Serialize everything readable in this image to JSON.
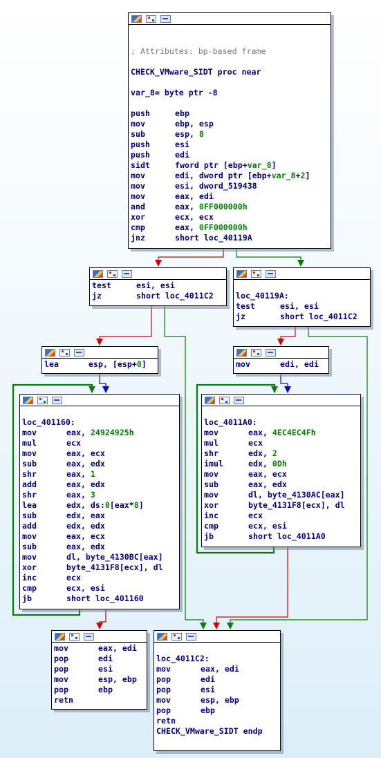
{
  "colors": {
    "edge_true": "#008000",
    "edge_false": "#d00000",
    "edge_uncond": "#0000ff",
    "text": "#000080",
    "number": "#008000",
    "comment": "#7a7a7a"
  },
  "node_header_icons": [
    "color-icon",
    "graph-icon",
    "text-icon"
  ],
  "nodes": [
    {
      "id": "n1",
      "lines": [
        {
          "type": "blank"
        },
        {
          "type": "blank"
        },
        {
          "type": "comment",
          "text": "; Attributes: bp-based frame"
        },
        {
          "type": "blank"
        },
        {
          "type": "label",
          "text": "CHECK_VMware_SIDT proc near"
        },
        {
          "type": "blank"
        },
        {
          "type": "label",
          "text": "var_8= byte ptr -8"
        },
        {
          "type": "blank"
        },
        {
          "type": "ins",
          "mnem": "push",
          "ops": [
            {
              "t": "ebp"
            }
          ]
        },
        {
          "type": "ins",
          "mnem": "mov",
          "ops": [
            {
              "t": "ebp, esp"
            }
          ]
        },
        {
          "type": "ins",
          "mnem": "sub",
          "ops": [
            {
              "t": "esp, "
            },
            {
              "t": "8",
              "n": true
            }
          ]
        },
        {
          "type": "ins",
          "mnem": "push",
          "ops": [
            {
              "t": "esi"
            }
          ]
        },
        {
          "type": "ins",
          "mnem": "push",
          "ops": [
            {
              "t": "edi"
            }
          ]
        },
        {
          "type": "ins",
          "mnem": "sidt",
          "ops": [
            {
              "t": "fword ptr [ebp+"
            },
            {
              "t": "var_8",
              "n": true
            },
            {
              "t": "]"
            }
          ]
        },
        {
          "type": "ins",
          "mnem": "mov",
          "ops": [
            {
              "t": "edi, dword ptr [ebp+"
            },
            {
              "t": "var_8",
              "n": true
            },
            {
              "t": "+"
            },
            {
              "t": "2",
              "n": true
            },
            {
              "t": "]"
            }
          ]
        },
        {
          "type": "ins",
          "mnem": "mov",
          "ops": [
            {
              "t": "esi, dword_519438"
            }
          ]
        },
        {
          "type": "ins",
          "mnem": "mov",
          "ops": [
            {
              "t": "eax, edi"
            }
          ]
        },
        {
          "type": "ins",
          "mnem": "and",
          "ops": [
            {
              "t": "eax, "
            },
            {
              "t": "0FF000000h",
              "n": true
            }
          ]
        },
        {
          "type": "ins",
          "mnem": "xor",
          "ops": [
            {
              "t": "ecx, ecx"
            }
          ]
        },
        {
          "type": "ins",
          "mnem": "cmp",
          "ops": [
            {
              "t": "eax, "
            },
            {
              "t": "0FF000000h",
              "n": true
            }
          ]
        },
        {
          "type": "ins",
          "mnem": "jnz",
          "ops": [
            {
              "t": "short loc_40119A"
            }
          ]
        }
      ]
    },
    {
      "id": "n2",
      "lines": [
        {
          "type": "ins",
          "mnem": "test",
          "ops": [
            {
              "t": "esi, esi"
            }
          ]
        },
        {
          "type": "ins",
          "mnem": "jz",
          "ops": [
            {
              "t": "short loc_4011C2"
            }
          ]
        }
      ]
    },
    {
      "id": "n3",
      "lines": [
        {
          "type": "blank"
        },
        {
          "type": "label",
          "text": "loc_40119A:"
        },
        {
          "type": "ins",
          "mnem": "test",
          "ops": [
            {
              "t": "esi, esi"
            }
          ]
        },
        {
          "type": "ins",
          "mnem": "jz",
          "ops": [
            {
              "t": "short loc_4011C2"
            }
          ]
        }
      ]
    },
    {
      "id": "n4",
      "lines": [
        {
          "type": "ins",
          "mnem": "lea",
          "ops": [
            {
              "t": "esp, [esp+"
            },
            {
              "t": "0",
              "n": true
            },
            {
              "t": "]"
            }
          ]
        }
      ]
    },
    {
      "id": "n5",
      "lines": [
        {
          "type": "ins",
          "mnem": "mov",
          "ops": [
            {
              "t": "edi, edi"
            }
          ]
        }
      ]
    },
    {
      "id": "n6",
      "lines": [
        {
          "type": "blank"
        },
        {
          "type": "label",
          "text": "loc_401160:"
        },
        {
          "type": "ins",
          "mnem": "mov",
          "ops": [
            {
              "t": "eax, "
            },
            {
              "t": "24924925h",
              "n": true
            }
          ]
        },
        {
          "type": "ins",
          "mnem": "mul",
          "ops": [
            {
              "t": "ecx"
            }
          ]
        },
        {
          "type": "ins",
          "mnem": "mov",
          "ops": [
            {
              "t": "eax, ecx"
            }
          ]
        },
        {
          "type": "ins",
          "mnem": "sub",
          "ops": [
            {
              "t": "eax, edx"
            }
          ]
        },
        {
          "type": "ins",
          "mnem": "shr",
          "ops": [
            {
              "t": "eax, "
            },
            {
              "t": "1",
              "n": true
            }
          ]
        },
        {
          "type": "ins",
          "mnem": "add",
          "ops": [
            {
              "t": "eax, edx"
            }
          ]
        },
        {
          "type": "ins",
          "mnem": "shr",
          "ops": [
            {
              "t": "eax, "
            },
            {
              "t": "3",
              "n": true
            }
          ]
        },
        {
          "type": "ins",
          "mnem": "lea",
          "ops": [
            {
              "t": "edx, ds:"
            },
            {
              "t": "0",
              "n": true
            },
            {
              "t": "[eax*"
            },
            {
              "t": "8",
              "n": true
            },
            {
              "t": "]"
            }
          ]
        },
        {
          "type": "ins",
          "mnem": "sub",
          "ops": [
            {
              "t": "edx, eax"
            }
          ]
        },
        {
          "type": "ins",
          "mnem": "add",
          "ops": [
            {
              "t": "edx, edx"
            }
          ]
        },
        {
          "type": "ins",
          "mnem": "mov",
          "ops": [
            {
              "t": "eax, ecx"
            }
          ]
        },
        {
          "type": "ins",
          "mnem": "sub",
          "ops": [
            {
              "t": "eax, edx"
            }
          ]
        },
        {
          "type": "ins",
          "mnem": "mov",
          "ops": [
            {
              "t": "dl, byte_4130BC[eax]"
            }
          ]
        },
        {
          "type": "ins",
          "mnem": "xor",
          "ops": [
            {
              "t": "byte_4131F8[ecx], dl"
            }
          ]
        },
        {
          "type": "ins",
          "mnem": "inc",
          "ops": [
            {
              "t": "ecx"
            }
          ]
        },
        {
          "type": "ins",
          "mnem": "cmp",
          "ops": [
            {
              "t": "ecx, esi"
            }
          ]
        },
        {
          "type": "ins",
          "mnem": "jb",
          "ops": [
            {
              "t": "short loc_401160"
            }
          ]
        }
      ]
    },
    {
      "id": "n7",
      "lines": [
        {
          "type": "blank"
        },
        {
          "type": "label",
          "text": "loc_4011A0:"
        },
        {
          "type": "ins",
          "mnem": "mov",
          "ops": [
            {
              "t": "eax, "
            },
            {
              "t": "4EC4EC4Fh",
              "n": true
            }
          ]
        },
        {
          "type": "ins",
          "mnem": "mul",
          "ops": [
            {
              "t": "ecx"
            }
          ]
        },
        {
          "type": "ins",
          "mnem": "shr",
          "ops": [
            {
              "t": "edx, "
            },
            {
              "t": "2",
              "n": true
            }
          ]
        },
        {
          "type": "ins",
          "mnem": "imul",
          "ops": [
            {
              "t": "edx, "
            },
            {
              "t": "0Dh",
              "n": true
            }
          ]
        },
        {
          "type": "ins",
          "mnem": "mov",
          "ops": [
            {
              "t": "eax, ecx"
            }
          ]
        },
        {
          "type": "ins",
          "mnem": "sub",
          "ops": [
            {
              "t": "eax, edx"
            }
          ]
        },
        {
          "type": "ins",
          "mnem": "mov",
          "ops": [
            {
              "t": "dl, byte_4130AC[eax]"
            }
          ]
        },
        {
          "type": "ins",
          "mnem": "xor",
          "ops": [
            {
              "t": "byte_4131F8[ecx], dl"
            }
          ]
        },
        {
          "type": "ins",
          "mnem": "inc",
          "ops": [
            {
              "t": "ecx"
            }
          ]
        },
        {
          "type": "ins",
          "mnem": "cmp",
          "ops": [
            {
              "t": "ecx, esi"
            }
          ]
        },
        {
          "type": "ins",
          "mnem": "jb",
          "ops": [
            {
              "t": "short loc_4011A0"
            }
          ]
        }
      ]
    },
    {
      "id": "n8",
      "lines": [
        {
          "type": "ins",
          "mnem": "mov",
          "ops": [
            {
              "t": "eax, edi"
            }
          ]
        },
        {
          "type": "ins",
          "mnem": "pop",
          "ops": [
            {
              "t": "edi"
            }
          ]
        },
        {
          "type": "ins",
          "mnem": "pop",
          "ops": [
            {
              "t": "esi"
            }
          ]
        },
        {
          "type": "ins",
          "mnem": "mov",
          "ops": [
            {
              "t": "esp, ebp"
            }
          ]
        },
        {
          "type": "ins",
          "mnem": "pop",
          "ops": [
            {
              "t": "ebp"
            }
          ]
        },
        {
          "type": "ins",
          "mnem": "retn",
          "ops": []
        }
      ]
    },
    {
      "id": "n9",
      "lines": [
        {
          "type": "blank"
        },
        {
          "type": "label",
          "text": "loc_4011C2:"
        },
        {
          "type": "ins",
          "mnem": "mov",
          "ops": [
            {
              "t": "eax, edi"
            }
          ]
        },
        {
          "type": "ins",
          "mnem": "pop",
          "ops": [
            {
              "t": "edi"
            }
          ]
        },
        {
          "type": "ins",
          "mnem": "pop",
          "ops": [
            {
              "t": "esi"
            }
          ]
        },
        {
          "type": "ins",
          "mnem": "mov",
          "ops": [
            {
              "t": "esp, ebp"
            }
          ]
        },
        {
          "type": "ins",
          "mnem": "pop",
          "ops": [
            {
              "t": "ebp"
            }
          ]
        },
        {
          "type": "ins",
          "mnem": "retn",
          "ops": []
        },
        {
          "type": "label",
          "text": "CHECK_VMware_SIDT endp"
        }
      ]
    }
  ],
  "edges": [
    {
      "from": "n1",
      "to": "n2",
      "kind": "false"
    },
    {
      "from": "n1",
      "to": "n3",
      "kind": "true"
    },
    {
      "from": "n2",
      "to": "n4",
      "kind": "false"
    },
    {
      "from": "n2",
      "to": "n9",
      "kind": "true"
    },
    {
      "from": "n3",
      "to": "n5",
      "kind": "false"
    },
    {
      "from": "n3",
      "to": "n9",
      "kind": "true"
    },
    {
      "from": "n4",
      "to": "n6",
      "kind": "uncond"
    },
    {
      "from": "n5",
      "to": "n7",
      "kind": "uncond"
    },
    {
      "from": "n6",
      "to": "n6",
      "kind": "true"
    },
    {
      "from": "n6",
      "to": "n8",
      "kind": "false"
    },
    {
      "from": "n7",
      "to": "n7",
      "kind": "true"
    },
    {
      "from": "n7",
      "to": "n9",
      "kind": "false"
    }
  ]
}
